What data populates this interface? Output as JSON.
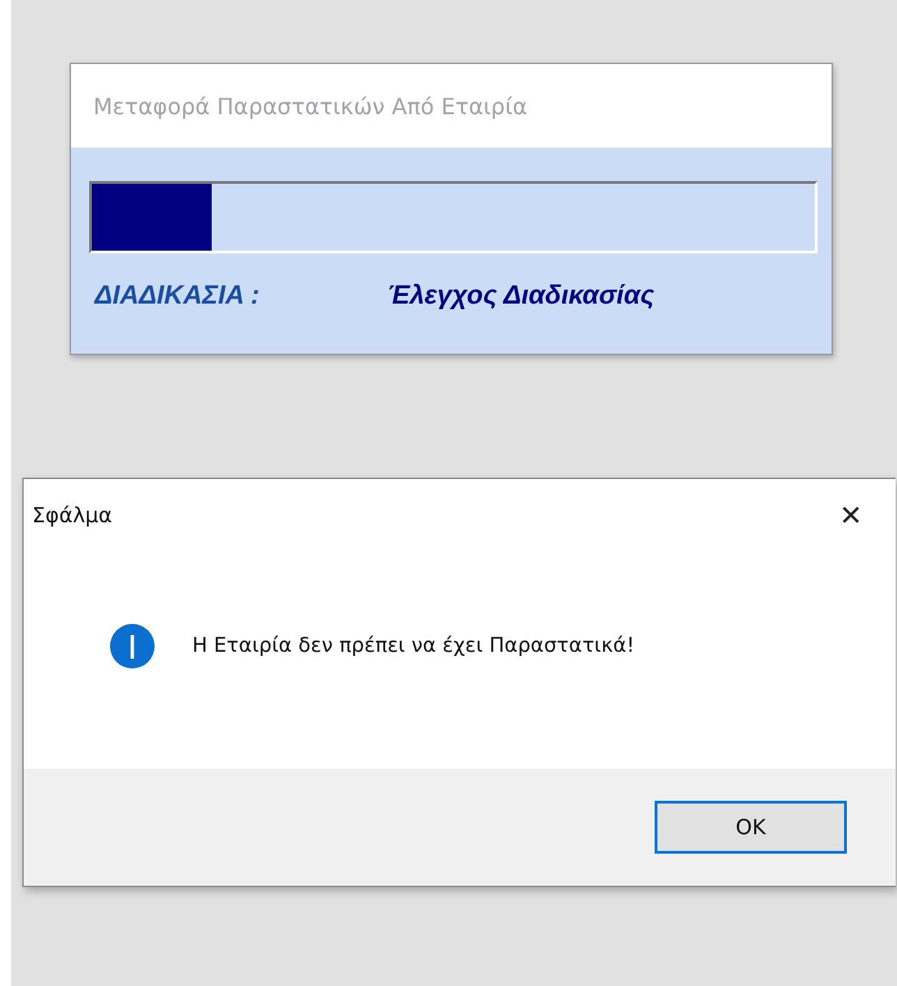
{
  "progress_window": {
    "title": "Μεταφορά Παραστατικών Από Εταιρία",
    "progress": {
      "level": 0.165
    },
    "process_label": "ΔΙΑΔΙΚΑΣΙΑ :",
    "process_value": "Έλεγχος Διαδικασίας"
  },
  "error_dialog": {
    "title": "Σφάλμα",
    "close": "✕",
    "icon": {
      "kind": "info"
    },
    "message": "Η Εταιρία δεν πρέπει να έχει Παραστατικά!",
    "buttons": [
      "OK"
    ]
  }
}
